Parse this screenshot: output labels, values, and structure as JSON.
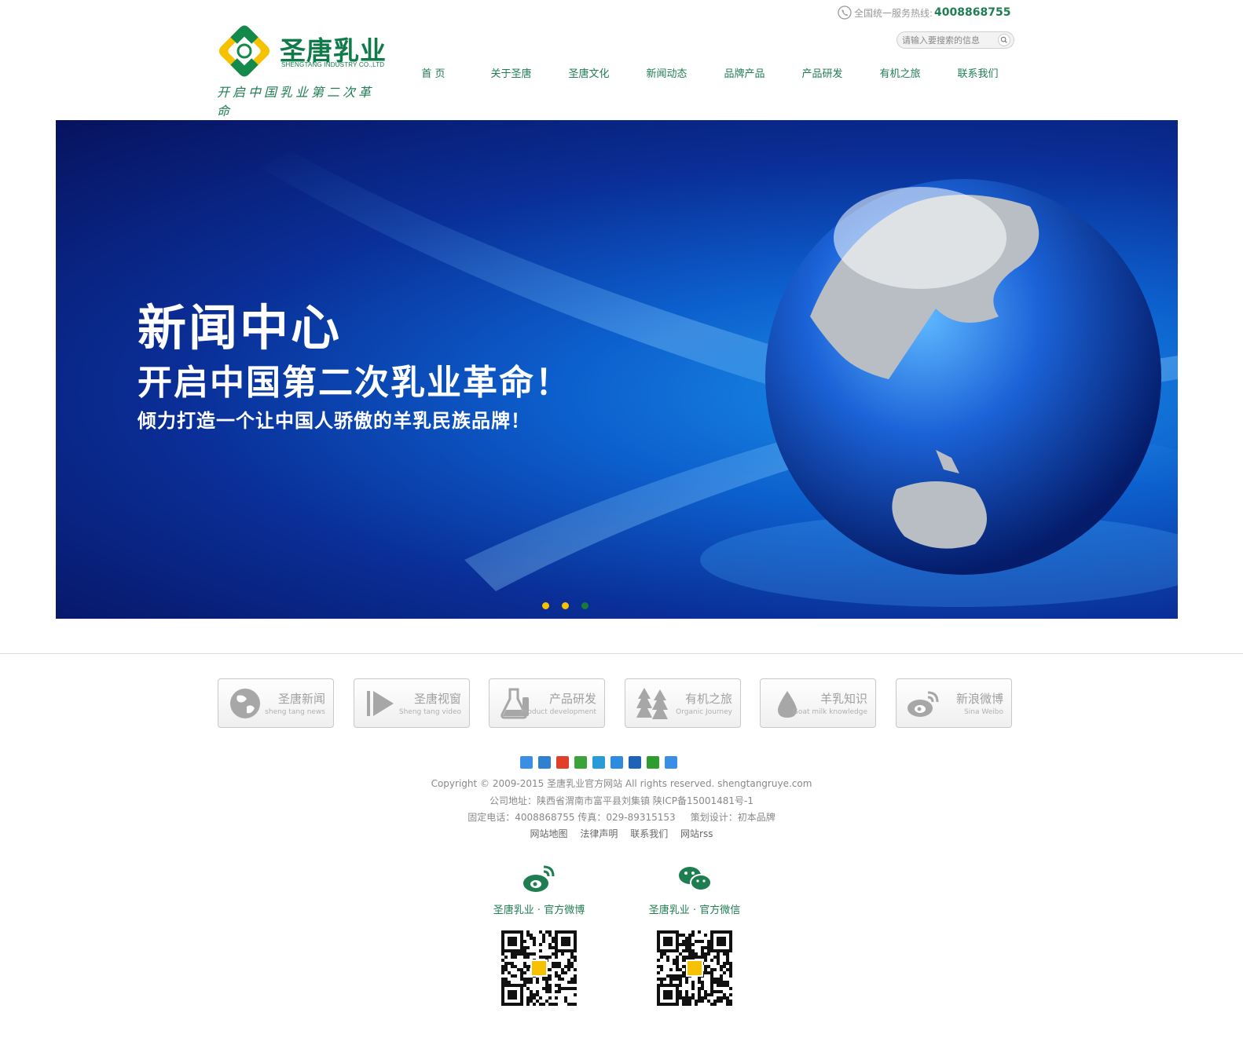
{
  "header": {
    "logo_cn": "圣唐乳业",
    "logo_en": "SHENGTANG INDUSTRY CO.,LTD",
    "slogan": "开启中国乳业第二次革命",
    "hotline_label": "全国统一服务热线:",
    "hotline_number": "4008868755",
    "search_placeholder": "请输入要搜索的信息"
  },
  "nav": {
    "items": [
      {
        "label": "首  页"
      },
      {
        "label": "关于圣唐"
      },
      {
        "label": "圣唐文化"
      },
      {
        "label": "新闻动态"
      },
      {
        "label": "品牌产品"
      },
      {
        "label": "产品研发"
      },
      {
        "label": "有机之旅"
      },
      {
        "label": "联系我们"
      }
    ]
  },
  "banner": {
    "title": "新闻中心",
    "subtitle": "开启中国第二次乳业革命！",
    "tagline": "倾力打造一个让中国人骄傲的羊乳民族品牌！",
    "dots": [
      {
        "color": "#f6c200"
      },
      {
        "color": "#f6c200"
      },
      {
        "color": "#1a7a3c"
      }
    ]
  },
  "categories": [
    {
      "cn": "圣唐新闻",
      "en": "sheng tang news",
      "icon": "globe-icon"
    },
    {
      "cn": "圣唐视窗",
      "en": "Sheng tang video",
      "icon": "play-icon"
    },
    {
      "cn": "产品研发",
      "en": "Product development",
      "icon": "flask-icon"
    },
    {
      "cn": "有机之旅",
      "en": "Organic Journey",
      "icon": "trees-icon"
    },
    {
      "cn": "羊乳知识",
      "en": "Goat milk knowledge",
      "icon": "drop-icon"
    },
    {
      "cn": "新浪微博",
      "en": "Sina Weibo",
      "icon": "weibo-icon"
    }
  ],
  "share_icons": [
    {
      "name": "share-plus-icon",
      "color": "#3a8ee6"
    },
    {
      "name": "share-qzone-icon",
      "color": "#2f7fd3"
    },
    {
      "name": "share-weibo-icon",
      "color": "#e0402a"
    },
    {
      "name": "share-wechat-icon",
      "color": "#3aa43a"
    },
    {
      "name": "share-tqq-icon",
      "color": "#2a9ad8"
    },
    {
      "name": "share-qq-icon",
      "color": "#2d8be0"
    },
    {
      "name": "share-renren-icon",
      "color": "#1f63b7"
    },
    {
      "name": "share-kaixin-icon",
      "color": "#2e9c2e"
    },
    {
      "name": "share-more-icon",
      "color": "#3a8ee6"
    }
  ],
  "footer": {
    "copyright": "Copyright © 2009-2015 圣唐乳业官方网站 All rights reserved. shengtangruye.com",
    "address": "公司地址：陕西省渭南市富平县刘集镇 陕ICP备15001481号-1",
    "contact": "固定电话：4008868755 传真：029-89315153     策划设计：初本品牌",
    "links": [
      "网站地图",
      "法律声明",
      "联系我们",
      "网站rss"
    ]
  },
  "social": [
    {
      "label": "圣唐乳业 · 官方微博",
      "icon": "weibo-icon"
    },
    {
      "label": "圣唐乳业 · 官方微信",
      "icon": "wechat-icon"
    }
  ],
  "colors": {
    "brand_green": "#1f7d52",
    "brand_yellow": "#f6c200"
  }
}
